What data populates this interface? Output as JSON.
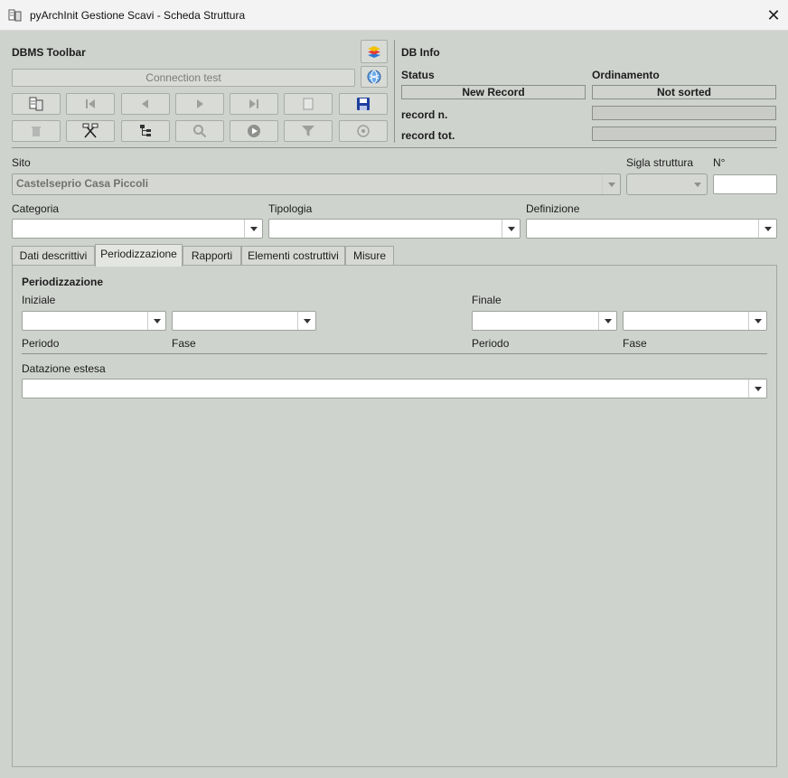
{
  "window": {
    "title": "pyArchInit Gestione Scavi - Scheda Struttura",
    "close_symbol": "✕"
  },
  "toolbar": {
    "title": "DBMS Toolbar",
    "connection_test": "Connection test"
  },
  "db_info": {
    "title": "DB Info",
    "status_label": "Status",
    "status_value": "New Record",
    "ordinamento_label": "Ordinamento",
    "ordinamento_value": "Not sorted",
    "record_n_label": "record n.",
    "record_tot_label": "record tot."
  },
  "fields": {
    "sito_label": "Sito",
    "sito_value": "Castelseprio Casa Piccoli",
    "sigla_label": "Sigla struttura",
    "numero_label": "N°",
    "categoria_label": "Categoria",
    "tipologia_label": "Tipologia",
    "definizione_label": "Definizione"
  },
  "tabs": [
    {
      "label": "Dati descrittivi"
    },
    {
      "label": "Periodizzazione"
    },
    {
      "label": "Rapporti"
    },
    {
      "label": "Elementi costruttivi"
    },
    {
      "label": "Misure"
    }
  ],
  "periodizzazione": {
    "title": "Periodizzazione",
    "iniziale_label": "Iniziale",
    "finale_label": "Finale",
    "periodo_label": "Periodo",
    "fase_label": "Fase",
    "datazione_label": "Datazione estesa"
  }
}
